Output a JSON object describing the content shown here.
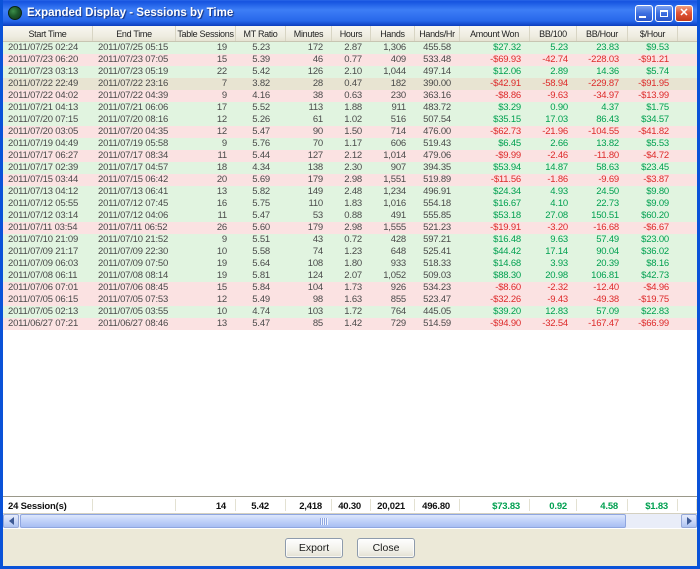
{
  "window": {
    "title": "Expanded Display - Sessions by Time",
    "controls": {
      "minimize": "minimize",
      "maximize": "maximize",
      "close": "close"
    }
  },
  "colors": {
    "titlebar_blue": "#2767ea",
    "win_row_bg": "#e1f4e0",
    "loss_row_bg": "#fbe2e2",
    "selected_row_bg": "#e8e4d2",
    "positive_text": "#00a050",
    "negative_text": "#dd2a2a"
  },
  "table": {
    "columns": [
      {
        "key": "start_time",
        "label": "Start Time"
      },
      {
        "key": "end_time",
        "label": "End Time"
      },
      {
        "key": "table_sessions",
        "label": "Table Sessions"
      },
      {
        "key": "mt_ratio",
        "label": "MT Ratio"
      },
      {
        "key": "minutes",
        "label": "Minutes"
      },
      {
        "key": "hours",
        "label": "Hours"
      },
      {
        "key": "hands",
        "label": "Hands"
      },
      {
        "key": "hands_hr",
        "label": "Hands/Hr"
      },
      {
        "key": "amount_won",
        "label": "Amount Won"
      },
      {
        "key": "bb_100",
        "label": "BB/100"
      },
      {
        "key": "bb_hour",
        "label": "BB/Hour"
      },
      {
        "key": "dollar_hour",
        "label": "$/Hour"
      }
    ],
    "rows": [
      {
        "result": "win",
        "selected": false,
        "cells": [
          "2011/07/25 02:24",
          "2011/07/25 05:15",
          "19",
          "5.23",
          "172",
          "2.87",
          "1,306",
          "455.58",
          "$27.32",
          "5.23",
          "23.83",
          "$9.53"
        ]
      },
      {
        "result": "loss",
        "selected": false,
        "cells": [
          "2011/07/23 06:20",
          "2011/07/23 07:05",
          "15",
          "5.39",
          "46",
          "0.77",
          "409",
          "533.48",
          "-$69.93",
          "-42.74",
          "-228.03",
          "-$91.21"
        ]
      },
      {
        "result": "win",
        "selected": false,
        "cells": [
          "2011/07/23 03:13",
          "2011/07/23 05:19",
          "22",
          "5.42",
          "126",
          "2.10",
          "1,044",
          "497.14",
          "$12.06",
          "2.89",
          "14.36",
          "$5.74"
        ]
      },
      {
        "result": "loss",
        "selected": true,
        "cells": [
          "2011/07/22 22:49",
          "2011/07/22 23:16",
          "7",
          "3.82",
          "28",
          "0.47",
          "182",
          "390.00",
          "-$42.91",
          "-58.94",
          "-229.87",
          "-$91.95"
        ]
      },
      {
        "result": "loss",
        "selected": false,
        "cells": [
          "2011/07/22 04:02",
          "2011/07/22 04:39",
          "9",
          "4.16",
          "38",
          "0.63",
          "230",
          "363.16",
          "-$8.86",
          "-9.63",
          "-34.97",
          "-$13.99"
        ]
      },
      {
        "result": "win",
        "selected": false,
        "cells": [
          "2011/07/21 04:13",
          "2011/07/21 06:06",
          "17",
          "5.52",
          "113",
          "1.88",
          "911",
          "483.72",
          "$3.29",
          "0.90",
          "4.37",
          "$1.75"
        ]
      },
      {
        "result": "win",
        "selected": false,
        "cells": [
          "2011/07/20 07:15",
          "2011/07/20 08:16",
          "12",
          "5.26",
          "61",
          "1.02",
          "516",
          "507.54",
          "$35.15",
          "17.03",
          "86.43",
          "$34.57"
        ]
      },
      {
        "result": "loss",
        "selected": false,
        "cells": [
          "2011/07/20 03:05",
          "2011/07/20 04:35",
          "12",
          "5.47",
          "90",
          "1.50",
          "714",
          "476.00",
          "-$62.73",
          "-21.96",
          "-104.55",
          "-$41.82"
        ]
      },
      {
        "result": "win",
        "selected": false,
        "cells": [
          "2011/07/19 04:49",
          "2011/07/19 05:58",
          "9",
          "5.76",
          "70",
          "1.17",
          "606",
          "519.43",
          "$6.45",
          "2.66",
          "13.82",
          "$5.53"
        ]
      },
      {
        "result": "loss",
        "selected": false,
        "cells": [
          "2011/07/17 06:27",
          "2011/07/17 08:34",
          "11",
          "5.44",
          "127",
          "2.12",
          "1,014",
          "479.06",
          "-$9.99",
          "-2.46",
          "-11.80",
          "-$4.72"
        ]
      },
      {
        "result": "win",
        "selected": false,
        "cells": [
          "2011/07/17 02:39",
          "2011/07/17 04:57",
          "18",
          "4.34",
          "138",
          "2.30",
          "907",
          "394.35",
          "$53.94",
          "14.87",
          "58.63",
          "$23.45"
        ]
      },
      {
        "result": "loss",
        "selected": false,
        "cells": [
          "2011/07/15 03:44",
          "2011/07/15 06:42",
          "20",
          "5.69",
          "179",
          "2.98",
          "1,551",
          "519.89",
          "-$11.56",
          "-1.86",
          "-9.69",
          "-$3.87"
        ]
      },
      {
        "result": "win",
        "selected": false,
        "cells": [
          "2011/07/13 04:12",
          "2011/07/13 06:41",
          "13",
          "5.82",
          "149",
          "2.48",
          "1,234",
          "496.91",
          "$24.34",
          "4.93",
          "24.50",
          "$9.80"
        ]
      },
      {
        "result": "win",
        "selected": false,
        "cells": [
          "2011/07/12 05:55",
          "2011/07/12 07:45",
          "16",
          "5.75",
          "110",
          "1.83",
          "1,016",
          "554.18",
          "$16.67",
          "4.10",
          "22.73",
          "$9.09"
        ]
      },
      {
        "result": "win",
        "selected": false,
        "cells": [
          "2011/07/12 03:14",
          "2011/07/12 04:06",
          "11",
          "5.47",
          "53",
          "0.88",
          "491",
          "555.85",
          "$53.18",
          "27.08",
          "150.51",
          "$60.20"
        ]
      },
      {
        "result": "loss",
        "selected": false,
        "cells": [
          "2011/07/11 03:54",
          "2011/07/11 06:52",
          "26",
          "5.60",
          "179",
          "2.98",
          "1,555",
          "521.23",
          "-$19.91",
          "-3.20",
          "-16.68",
          "-$6.67"
        ]
      },
      {
        "result": "win",
        "selected": false,
        "cells": [
          "2011/07/10 21:09",
          "2011/07/10 21:52",
          "9",
          "5.51",
          "43",
          "0.72",
          "428",
          "597.21",
          "$16.48",
          "9.63",
          "57.49",
          "$23.00"
        ]
      },
      {
        "result": "win",
        "selected": false,
        "cells": [
          "2011/07/09 21:17",
          "2011/07/09 22:30",
          "10",
          "5.58",
          "74",
          "1.23",
          "648",
          "525.41",
          "$44.42",
          "17.14",
          "90.04",
          "$36.02"
        ]
      },
      {
        "result": "win",
        "selected": false,
        "cells": [
          "2011/07/09 06:03",
          "2011/07/09 07:50",
          "19",
          "5.64",
          "108",
          "1.80",
          "933",
          "518.33",
          "$14.68",
          "3.93",
          "20.39",
          "$8.16"
        ]
      },
      {
        "result": "win",
        "selected": false,
        "cells": [
          "2011/07/08 06:11",
          "2011/07/08 08:14",
          "19",
          "5.81",
          "124",
          "2.07",
          "1,052",
          "509.03",
          "$88.30",
          "20.98",
          "106.81",
          "$42.73"
        ]
      },
      {
        "result": "loss",
        "selected": false,
        "cells": [
          "2011/07/06 07:01",
          "2011/07/06 08:45",
          "15",
          "5.84",
          "104",
          "1.73",
          "926",
          "534.23",
          "-$8.60",
          "-2.32",
          "-12.40",
          "-$4.96"
        ]
      },
      {
        "result": "loss",
        "selected": false,
        "cells": [
          "2011/07/05 06:15",
          "2011/07/05 07:53",
          "12",
          "5.49",
          "98",
          "1.63",
          "855",
          "523.47",
          "-$32.26",
          "-9.43",
          "-49.38",
          "-$19.75"
        ]
      },
      {
        "result": "win",
        "selected": false,
        "cells": [
          "2011/07/05 02:13",
          "2011/07/05 03:55",
          "10",
          "4.74",
          "103",
          "1.72",
          "764",
          "445.05",
          "$39.20",
          "12.83",
          "57.09",
          "$22.83"
        ]
      },
      {
        "result": "loss",
        "selected": false,
        "cells": [
          "2011/06/27 07:21",
          "2011/06/27 08:46",
          "13",
          "5.47",
          "85",
          "1.42",
          "729",
          "514.59",
          "-$94.90",
          "-32.54",
          "-167.47",
          "-$66.99"
        ]
      }
    ],
    "totals": {
      "cells": [
        "24 Session(s)",
        "",
        "14",
        "5.42",
        "2,418",
        "40.30",
        "20,021",
        "496.80",
        "$73.83",
        "0.92",
        "4.58",
        "$1.83"
      ]
    }
  },
  "buttons": {
    "export": "Export",
    "close": "Close"
  }
}
